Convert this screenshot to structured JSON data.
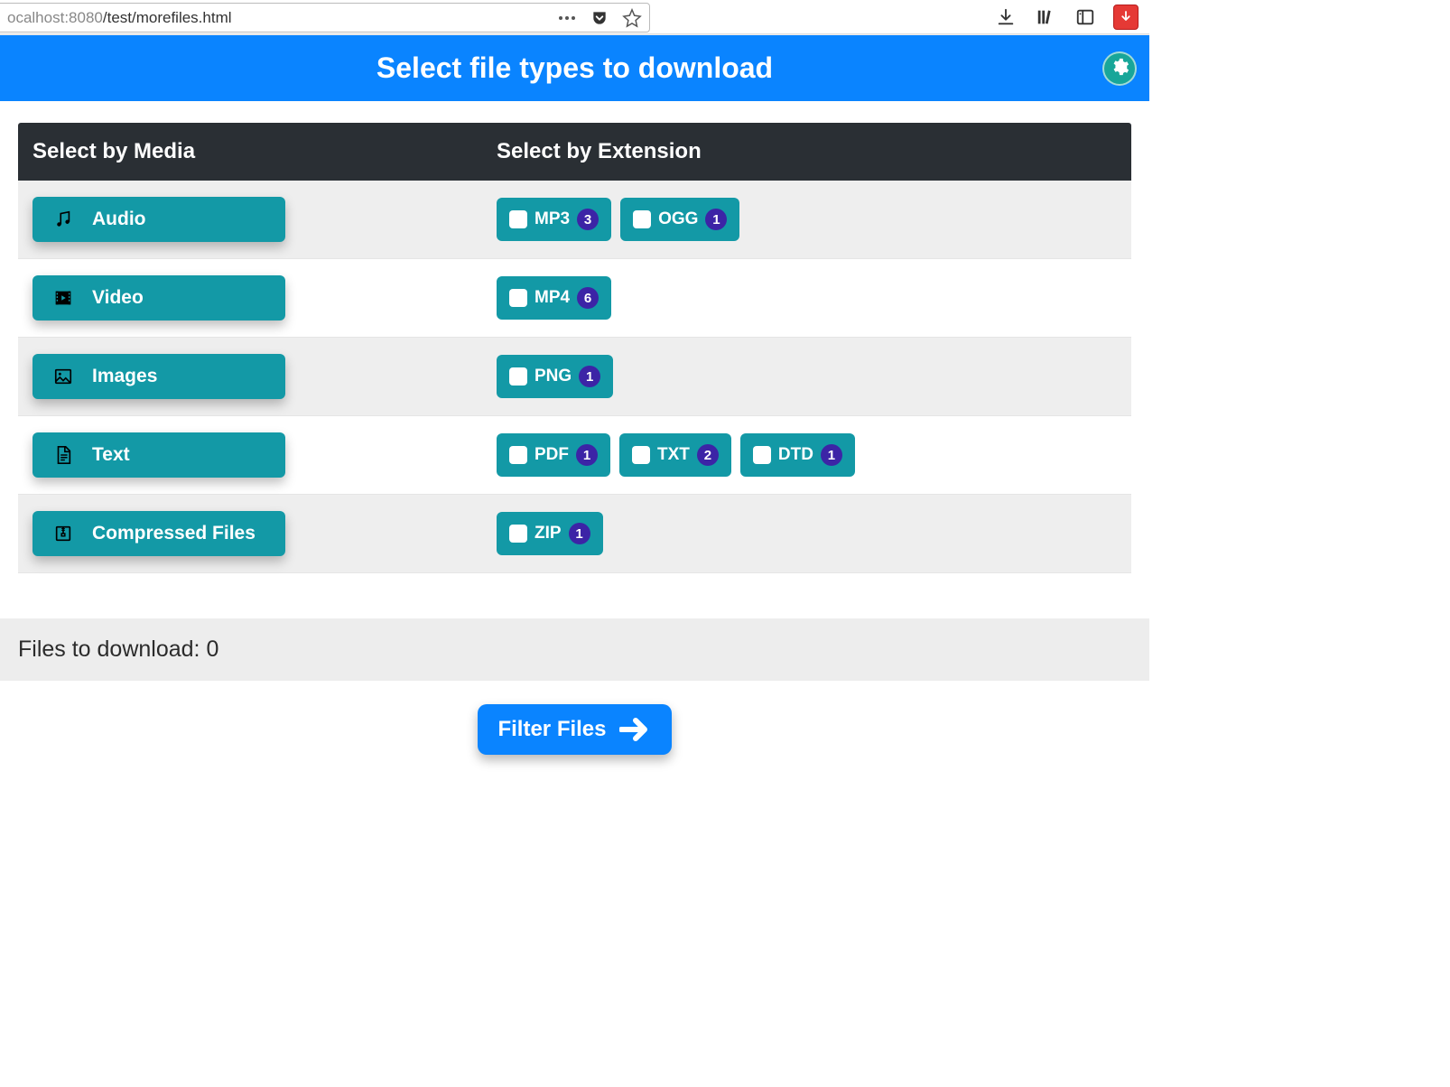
{
  "browser": {
    "url_prefix_gray": "ocalhost:",
    "url_port": "8080",
    "url_path": "/test/morefiles.html"
  },
  "header": {
    "title": "Select file types to download"
  },
  "section_headers": {
    "media": "Select by Media",
    "extension": "Select by Extension"
  },
  "rows": [
    {
      "media_label": "Audio",
      "media_icon": "music",
      "extensions": [
        {
          "label": "MP3",
          "count": "3"
        },
        {
          "label": "OGG",
          "count": "1"
        }
      ]
    },
    {
      "media_label": "Video",
      "media_icon": "film",
      "extensions": [
        {
          "label": "MP4",
          "count": "6"
        }
      ]
    },
    {
      "media_label": "Images",
      "media_icon": "image",
      "extensions": [
        {
          "label": "PNG",
          "count": "1"
        }
      ]
    },
    {
      "media_label": "Text",
      "media_icon": "document",
      "extensions": [
        {
          "label": "PDF",
          "count": "1"
        },
        {
          "label": "TXT",
          "count": "2"
        },
        {
          "label": "DTD",
          "count": "1"
        }
      ]
    },
    {
      "media_label": "Compressed Files",
      "media_icon": "archive",
      "extensions": [
        {
          "label": "ZIP",
          "count": "1"
        }
      ]
    }
  ],
  "status": {
    "label": "Files to download: ",
    "count": "0"
  },
  "filter_button": {
    "label": "Filter Files"
  },
  "colors": {
    "primary_blue": "#0a84ff",
    "teal": "#1399a6",
    "teal_dark": "#18a699",
    "badge_purple": "#3c24a6",
    "header_dark": "#2a2f34"
  }
}
